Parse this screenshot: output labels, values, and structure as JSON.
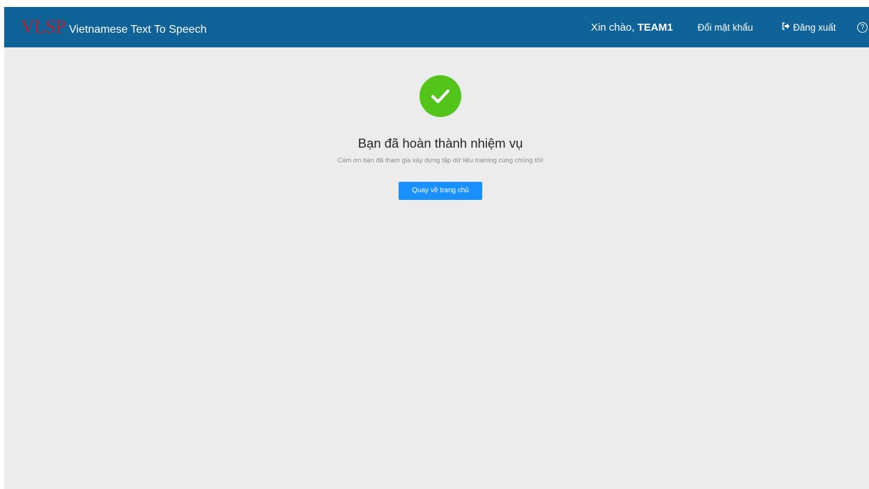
{
  "navbar": {
    "logo_text": "VLSP",
    "app_title": "Vietnamese Text To Speech",
    "greeting_prefix": "Xin chào,",
    "username": "TEAM1",
    "change_password_label": "Đổi mật khẩu",
    "logout_label": "Đăng xuất",
    "help_icon": "?"
  },
  "result": {
    "status_icon": "check-circle-icon",
    "title": "Bạn đã hoàn thành nhiệm vụ",
    "subtitle": "Cám ơn bạn đã tham gia xây dựng tập dữ liệu training cùng chúng tôi!",
    "home_button_label": "Quay về trang chủ"
  },
  "colors": {
    "navbar_bg": "#0f6398",
    "logo": "#b3202a",
    "success": "#52c41a",
    "primary_button": "#1890ff",
    "page_bg": "#ececec"
  }
}
